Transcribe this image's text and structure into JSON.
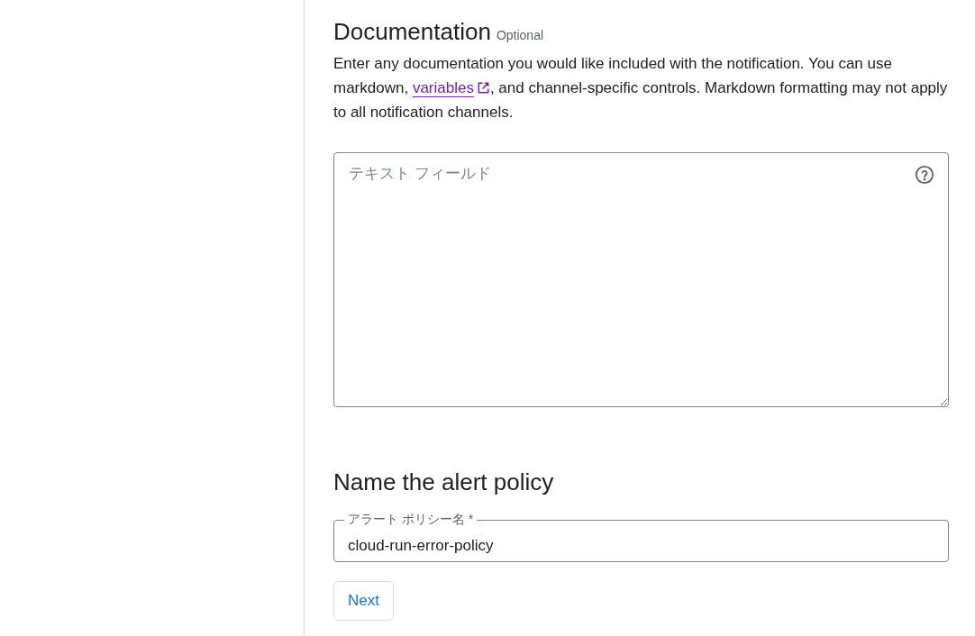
{
  "documentation": {
    "title": "Documentation",
    "badge": "Optional",
    "description": {
      "before": "Enter any documentation you would like included with the notification. You can use markdown, ",
      "link": "variables",
      "after": ", and channel-specific controls. Markdown formatting may not apply to all notification channels."
    },
    "field": {
      "placeholder": "テキスト フィールド"
    }
  },
  "policy_name": {
    "title": "Name the alert policy",
    "field": {
      "label": "アラート ポリシー名 *",
      "value": "cloud-run-error-policy"
    }
  },
  "buttons": [
    {
      "label": "Next",
      "kind": "outline"
    }
  ]
}
